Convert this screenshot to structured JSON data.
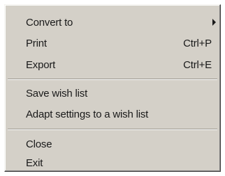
{
  "menu": {
    "items": [
      {
        "label": "Convert to",
        "shortcut": "",
        "submenu": true
      },
      {
        "label": "Print",
        "shortcut": "Ctrl+P"
      },
      {
        "label": "Export",
        "shortcut": "Ctrl+E"
      },
      {
        "label": "Save wish list",
        "shortcut": ""
      },
      {
        "label": "Adapt settings to a wish list",
        "shortcut": ""
      },
      {
        "label": "Close",
        "shortcut": ""
      },
      {
        "label": "Exit",
        "shortcut": ""
      }
    ]
  },
  "colors": {
    "menu_background": "#d4d0c8",
    "text": "#1a1a1a",
    "separator_shadow": "#9a978f",
    "separator_highlight": "#ffffff"
  },
  "icons": {
    "submenu_arrow": "submenu-arrow-icon"
  }
}
